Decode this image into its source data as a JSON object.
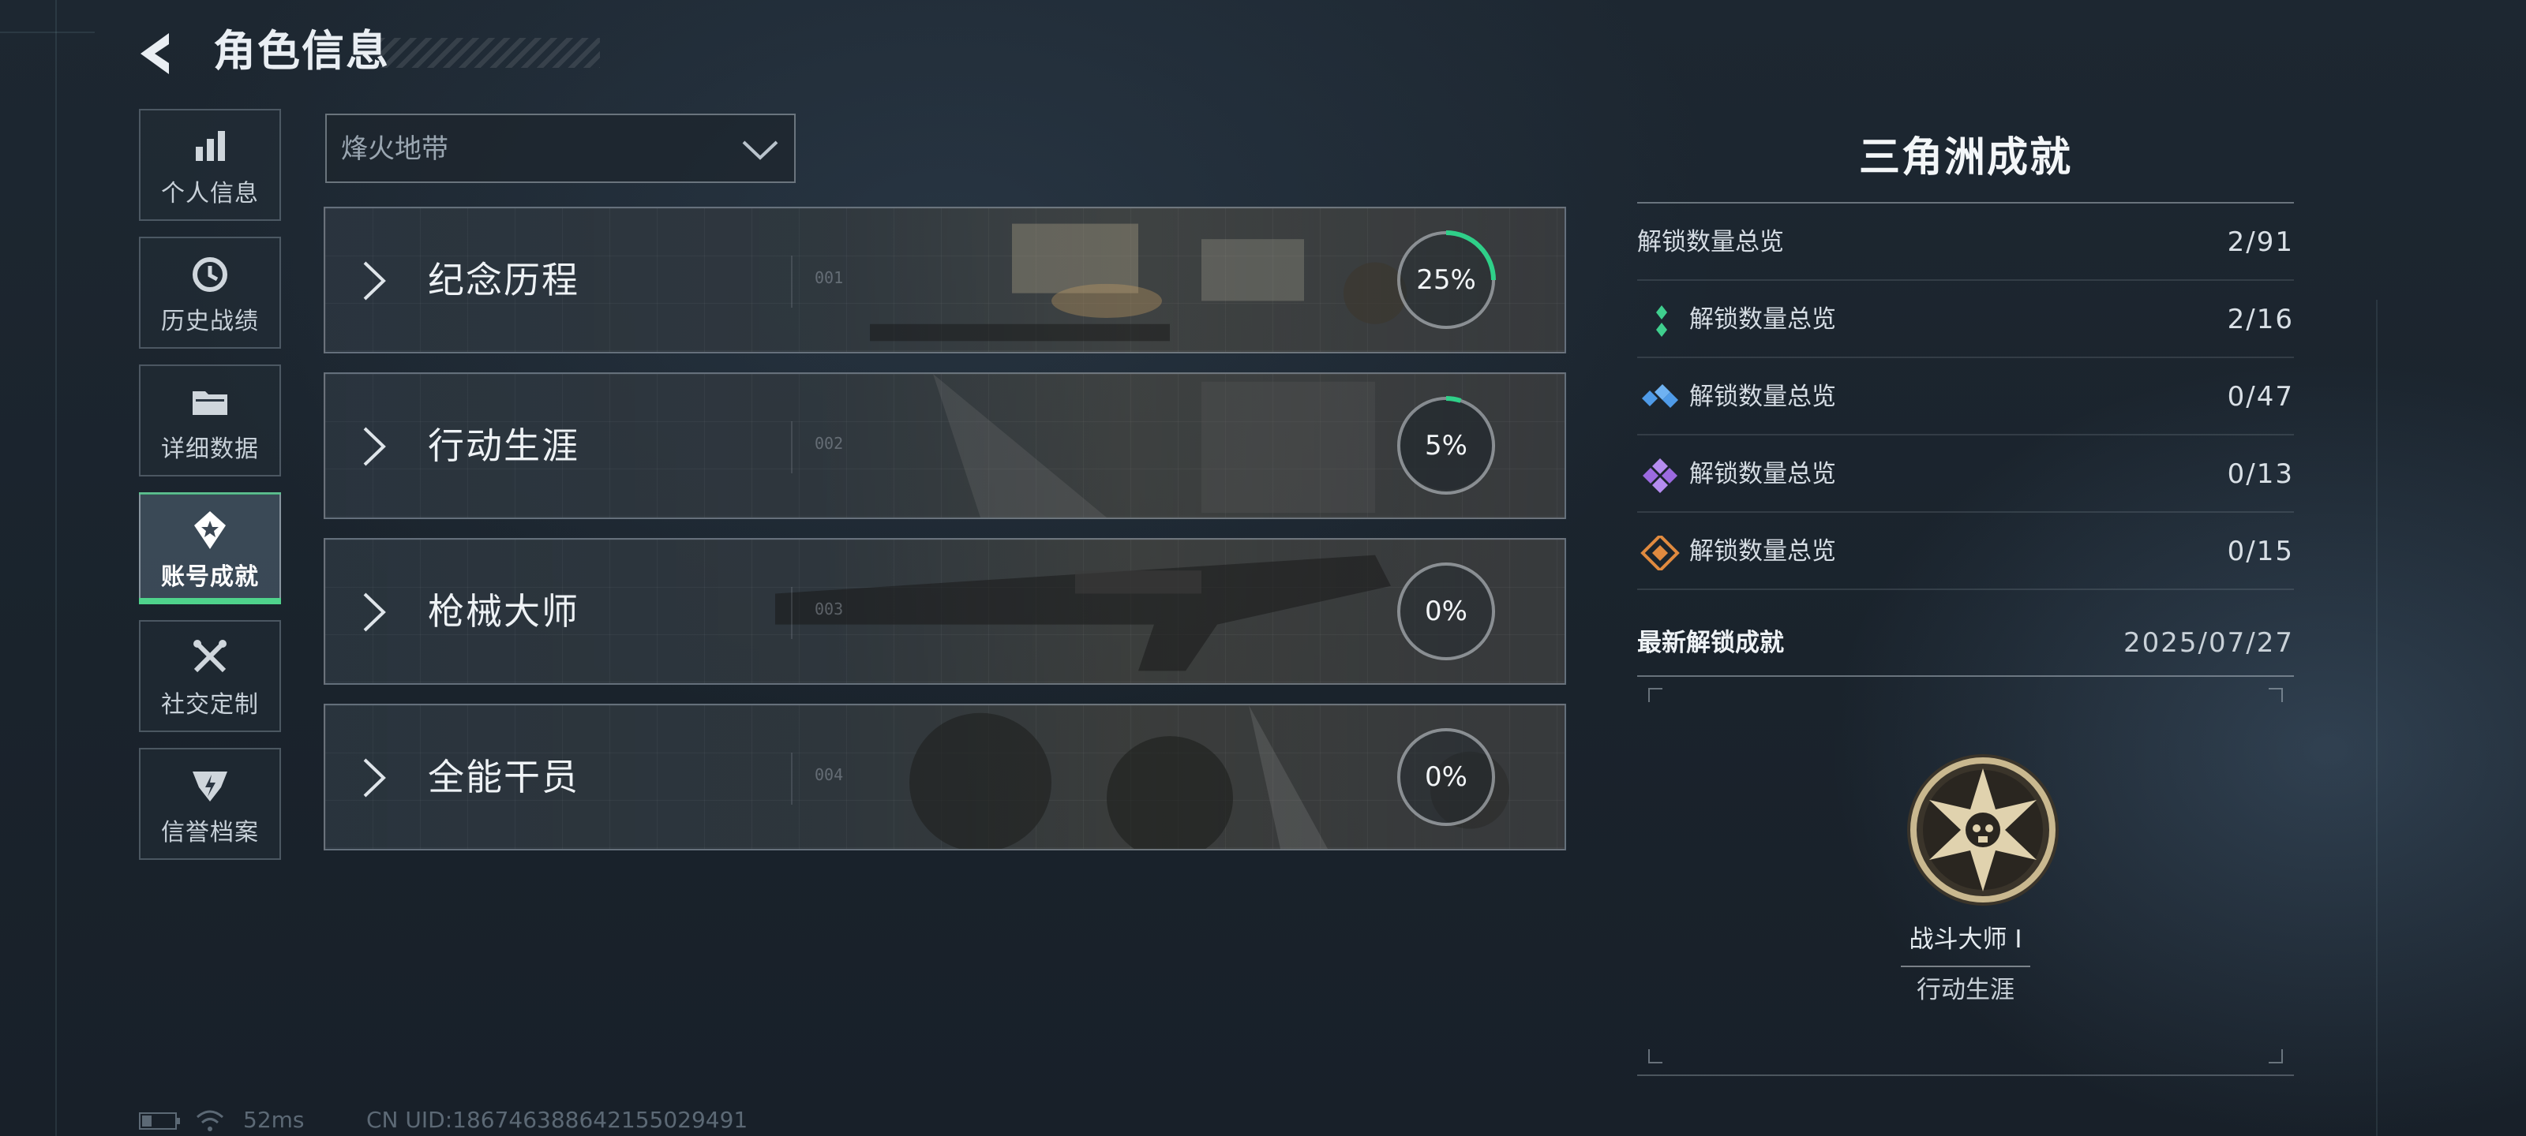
{
  "header": {
    "title": "角色信息"
  },
  "nav": {
    "items": [
      {
        "label": "个人信息",
        "icon": "bar-chart-icon",
        "active": false
      },
      {
        "label": "历史战绩",
        "icon": "history-clock-icon",
        "active": false
      },
      {
        "label": "详细数据",
        "icon": "folder-icon",
        "active": false
      },
      {
        "label": "账号成就",
        "icon": "achievement-star-icon",
        "active": true
      },
      {
        "label": "社交定制",
        "icon": "tools-icon",
        "active": false
      },
      {
        "label": "信誉档案",
        "icon": "credit-badge-icon",
        "active": false
      }
    ]
  },
  "mode_select": {
    "value": "烽火地带"
  },
  "categories": [
    {
      "title": "纪念历程",
      "number": "001",
      "progress_label": "25%",
      "progress": 0.25
    },
    {
      "title": "行动生涯",
      "number": "002",
      "progress_label": "5%",
      "progress": 0.05
    },
    {
      "title": "枪械大师",
      "number": "003",
      "progress_label": "0%",
      "progress": 0.0
    },
    {
      "title": "全能干员",
      "number": "004",
      "progress_label": "0%",
      "progress": 0.0
    }
  ],
  "summary": {
    "title": "三角洲成就",
    "rows": [
      {
        "label": "解锁数量总览",
        "value": "2/91",
        "icon": "none"
      },
      {
        "label": "解锁数量总览",
        "value": "2/16",
        "icon": "green-diamond-icon",
        "color": "#3fcf8e"
      },
      {
        "label": "解锁数量总览",
        "value": "0/47",
        "icon": "blue-diamond-icon",
        "color": "#4f9be8"
      },
      {
        "label": "解锁数量总览",
        "value": "0/13",
        "icon": "purple-diamond-icon",
        "color": "#9c6ae0"
      },
      {
        "label": "解锁数量总览",
        "value": "0/15",
        "icon": "orange-diamond-icon",
        "color": "#e08a3f"
      }
    ],
    "latest_label": "最新解锁成就",
    "latest_date": "2025/07/27",
    "latest": {
      "name": "战斗大师 I",
      "category": "行动生涯",
      "icon": "star-skull-medal-icon"
    }
  },
  "footer": {
    "latency": "52ms",
    "uid": "CN UID:1867463886421550294​91"
  },
  "colors": {
    "accent_green": "#4fd38c",
    "ring_green": "#2fd089"
  }
}
